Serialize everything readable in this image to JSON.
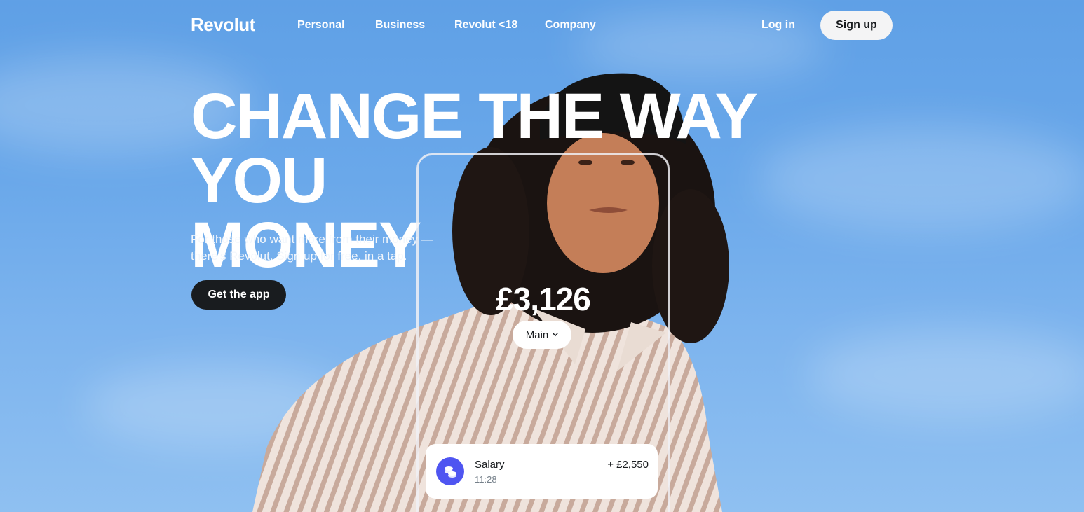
{
  "brand": {
    "logo": "Revolut"
  },
  "nav": {
    "links": [
      "Personal",
      "Business",
      "Revolut <18",
      "Company"
    ],
    "login": "Log in",
    "signup": "Sign up"
  },
  "hero": {
    "headline_line1": "CHANGE THE WAY YOU",
    "headline_line2": "MONEY",
    "subtext_line1": "For those who want more from their money —",
    "subtext_line2": "there's Revolut. Sign up for free, in a tap.",
    "cta": "Get the app"
  },
  "phone": {
    "balance": "£3,126",
    "account": "Main",
    "transaction": {
      "title": "Salary",
      "time": "11:28",
      "amount": "+ £2,550",
      "icon": "coins-icon"
    }
  },
  "colors": {
    "sky": "#6aa8ea",
    "dark": "#191c1f",
    "accent": "#4f55f1"
  }
}
